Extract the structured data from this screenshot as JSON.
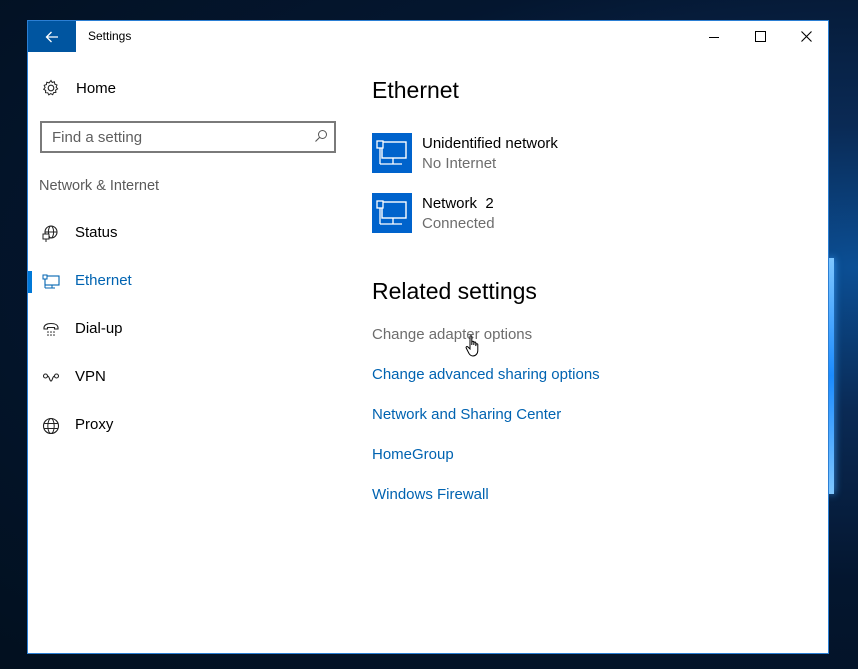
{
  "window": {
    "title": "Settings",
    "back_icon": "arrow-left-icon",
    "controls": {
      "minimize_icon": "minimize-icon",
      "maximize_icon": "maximize-icon",
      "close_icon": "close-icon"
    }
  },
  "sidebar": {
    "home": {
      "label": "Home",
      "icon": "gear-icon"
    },
    "search": {
      "placeholder": "Find a setting",
      "value": "",
      "icon": "search-icon"
    },
    "section_label": "Network & Internet",
    "items": [
      {
        "label": "Status",
        "icon": "status-globe-icon",
        "active": false
      },
      {
        "label": "Ethernet",
        "icon": "ethernet-icon",
        "active": true
      },
      {
        "label": "Dial-up",
        "icon": "phone-icon",
        "active": false
      },
      {
        "label": "VPN",
        "icon": "vpn-icon",
        "active": false
      },
      {
        "label": "Proxy",
        "icon": "globe-icon",
        "active": false
      }
    ]
  },
  "main": {
    "title": "Ethernet",
    "networks": [
      {
        "name": "Unidentified network",
        "status": "No Internet",
        "icon": "ethernet-monitor-icon"
      },
      {
        "name": "Network  2",
        "status": "Connected",
        "icon": "ethernet-monitor-icon"
      }
    ],
    "related_title": "Related settings",
    "related_links": [
      {
        "label": "Change adapter options",
        "state": "hover"
      },
      {
        "label": "Change advanced sharing options",
        "state": "normal"
      },
      {
        "label": "Network and Sharing Center",
        "state": "normal"
      },
      {
        "label": "HomeGroup",
        "state": "normal"
      },
      {
        "label": "Windows Firewall",
        "state": "normal"
      }
    ]
  },
  "colors": {
    "accent": "#0078d7",
    "link": "#0063b1",
    "back_button_bg": "#0055a0",
    "tile_bg": "#0063cc",
    "secondary_text": "#6d6d6d"
  }
}
